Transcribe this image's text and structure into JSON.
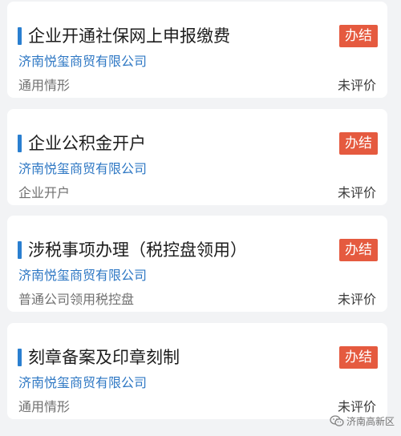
{
  "items": [
    {
      "title": "企业开通社保网上申报缴费",
      "status": "办结",
      "company": "济南悦玺商贸有限公司",
      "category": "通用情形",
      "rating": "未评价"
    },
    {
      "title": "企业公积金开户",
      "status": "办结",
      "company": "济南悦玺商贸有限公司",
      "category": "企业开户",
      "rating": "未评价"
    },
    {
      "title": "涉税事项办理（税控盘领用）",
      "status": "办结",
      "company": "济南悦玺商贸有限公司",
      "category": "普通公司领用税控盘",
      "rating": "未评价"
    },
    {
      "title": "刻章备案及印章刻制",
      "status": "办结",
      "company": "济南悦玺商贸有限公司",
      "category": "通用情形",
      "rating": "未评价"
    }
  ],
  "watermark": {
    "text": "济南高新区",
    "icon": "wechat-icon"
  },
  "colors": {
    "accent_bar": "#2a7fd0",
    "badge": "#e55a3f",
    "company_text": "#2f78c4"
  }
}
